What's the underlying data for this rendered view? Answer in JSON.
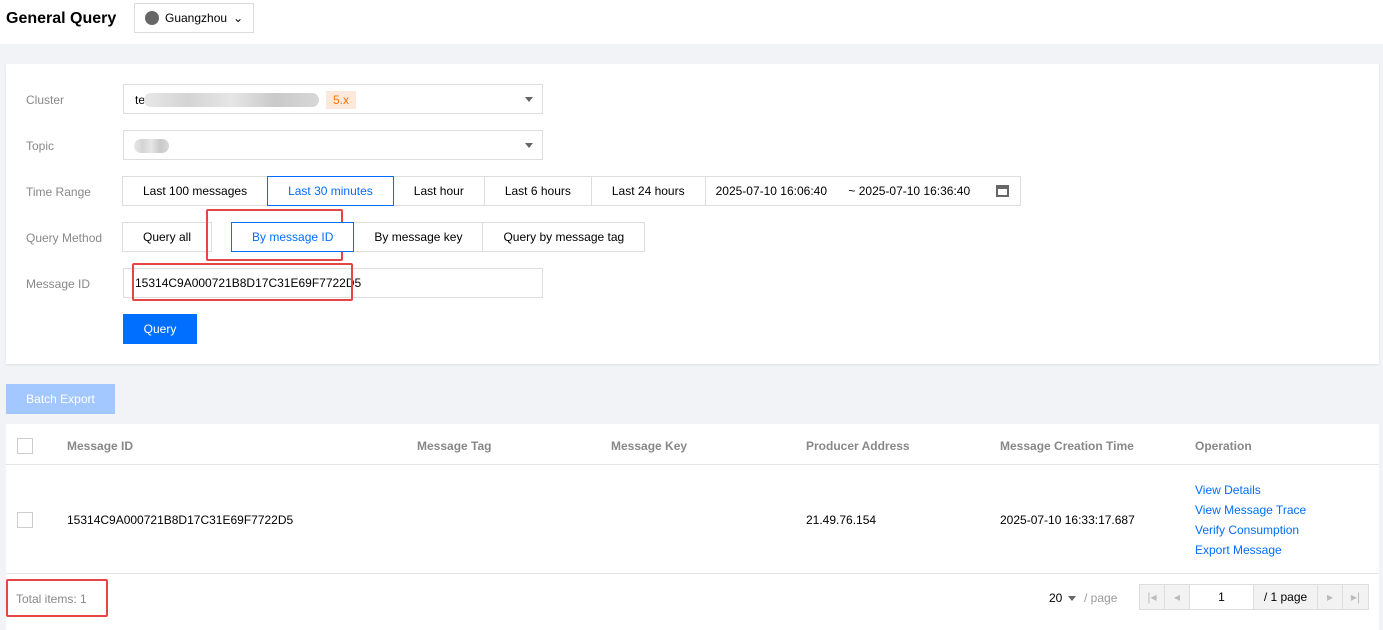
{
  "header": {
    "title": "General Query",
    "region": "Guangzhou"
  },
  "form": {
    "cluster_label": "Cluster",
    "cluster_prefix": "te",
    "cluster_version": "5.x",
    "topic_label": "Topic",
    "time_label": "Time Range",
    "time_options": [
      "Last 100 messages",
      "Last 30 minutes",
      "Last hour",
      "Last 6 hours",
      "Last 24 hours"
    ],
    "time_start": "2025-07-10 16:06:40",
    "time_end": "~ 2025-07-10 16:36:40",
    "method_label": "Query Method",
    "methods": [
      "Query all",
      "By message ID",
      "By message key",
      "Query by message tag"
    ],
    "msgid_label": "Message ID",
    "msgid_value": "15314C9A000721B8D17C31E69F7722D5",
    "query_button": "Query"
  },
  "batch_export": "Batch Export",
  "table": {
    "columns": [
      "Message ID",
      "Message Tag",
      "Message Key",
      "Producer Address",
      "Message Creation Time",
      "Operation"
    ],
    "rows": [
      {
        "id": "15314C9A000721B8D17C31E69F7722D5",
        "tag": "",
        "key": "",
        "producer": "21.49.76.154",
        "time": "2025-07-10 16:33:17.687",
        "ops": [
          "View Details",
          "View Message Trace",
          "Verify Consumption",
          "Export Message"
        ]
      }
    ]
  },
  "footer": {
    "total": "Total items:  1",
    "page_size": "20",
    "per_page": "/ page",
    "page": "1",
    "page_total": "/ 1 page"
  },
  "colors": {
    "accent": "#006eff",
    "highlight": "#e54545"
  }
}
